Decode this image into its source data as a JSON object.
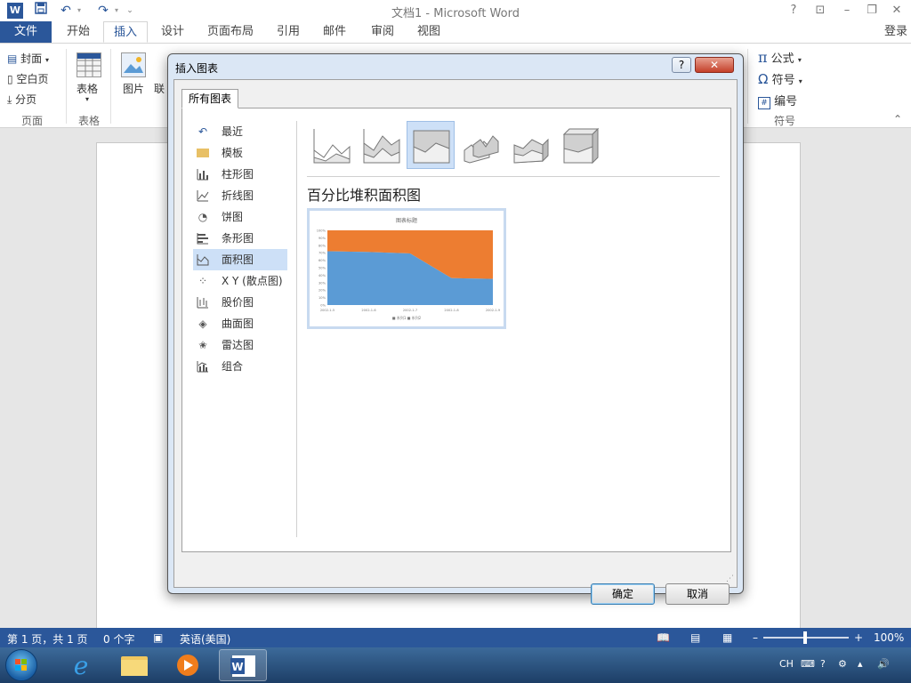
{
  "titlebar": {
    "app_icon": "W",
    "title": "文档1 - Microsoft Word",
    "qa_save_icon": "save-icon",
    "qa_undo_icon": "undo-icon",
    "qa_redo_icon": "redo-icon",
    "help": "?",
    "restore_ribbon": "⊡",
    "minimize": "–",
    "maximize": "❐",
    "close": "✕"
  },
  "ribbon_tabs": {
    "file": "文件",
    "items": [
      "开始",
      "插入",
      "设计",
      "页面布局",
      "引用",
      "邮件",
      "审阅",
      "视图"
    ],
    "active": "插入",
    "login": "登录"
  },
  "ribbon": {
    "pages_group": {
      "cover": "封面",
      "blank": "空白页",
      "break": "分页",
      "label": "页面"
    },
    "table_group": {
      "table": "表格",
      "label": "表格"
    },
    "pictures": "图片",
    "online": "联",
    "symbols_group": {
      "equation": "公式",
      "symbol": "符号",
      "number": "编号",
      "label": "符号"
    }
  },
  "dialog": {
    "title": "插入图表",
    "help": "?",
    "close": "✕",
    "tab": "所有图表",
    "categories": [
      {
        "label": "最近",
        "icon": "recent-icon"
      },
      {
        "label": "模板",
        "icon": "folder-icon"
      },
      {
        "label": "柱形图",
        "icon": "column-chart-icon"
      },
      {
        "label": "折线图",
        "icon": "line-chart-icon"
      },
      {
        "label": "饼图",
        "icon": "pie-chart-icon"
      },
      {
        "label": "条形图",
        "icon": "bar-chart-icon"
      },
      {
        "label": "面积图",
        "icon": "area-chart-icon"
      },
      {
        "label": "X Y (散点图)",
        "icon": "scatter-chart-icon"
      },
      {
        "label": "股价图",
        "icon": "stock-chart-icon"
      },
      {
        "label": "曲面图",
        "icon": "surface-chart-icon"
      },
      {
        "label": "雷达图",
        "icon": "radar-chart-icon"
      },
      {
        "label": "组合",
        "icon": "combo-chart-icon"
      }
    ],
    "selected_category": "面积图",
    "subtypes": [
      "area",
      "stacked-area",
      "percent-stacked-area",
      "3d-area",
      "3d-stacked-area",
      "3d-percent-stacked-area"
    ],
    "selected_subtype": "percent-stacked-area",
    "subtype_title": "百分比堆积面积图",
    "ok": "确定",
    "cancel": "取消"
  },
  "preview_chart": {
    "title": "图表标题",
    "legend": "■ 系列1 ■ 系列2",
    "yticks": [
      "100%",
      "90%",
      "80%",
      "70%",
      "60%",
      "50%",
      "40%",
      "30%",
      "20%",
      "10%",
      "0%"
    ],
    "xticks": [
      "2002-1-5",
      "2002-1-6",
      "2002-1-7",
      "2002-1-8",
      "2002-1-9"
    ],
    "colors": {
      "series1": "#5b9bd5",
      "series2": "#ed7d31"
    }
  },
  "chart_data": {
    "type": "area",
    "stacking": "percent",
    "title": "图表标题",
    "categories": [
      "2002-1-5",
      "2002-1-6",
      "2002-1-7",
      "2002-1-8",
      "2002-1-9"
    ],
    "series": [
      {
        "name": "系列1",
        "values": [
          72,
          71,
          69,
          36,
          35
        ]
      },
      {
        "name": "系列2",
        "values": [
          28,
          29,
          31,
          64,
          65
        ]
      }
    ],
    "ylim": [
      0,
      100
    ]
  },
  "status": {
    "page": "第 1 页，共 1 页",
    "words": "0 个字",
    "language": "英语(美国)",
    "zoom": "100%"
  },
  "taskbar": {
    "tray": [
      "CH"
    ]
  }
}
